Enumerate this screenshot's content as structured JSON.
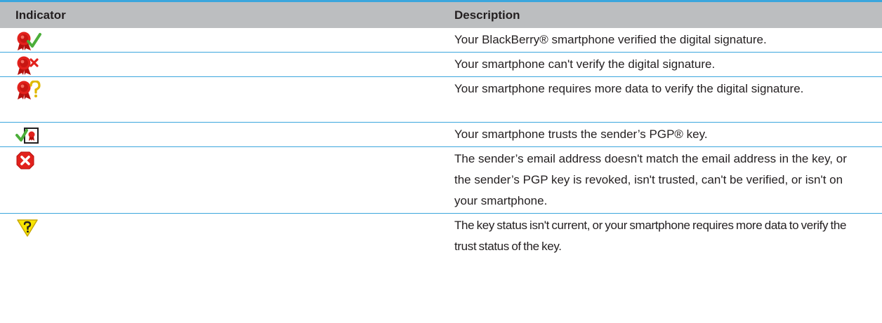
{
  "table": {
    "headers": {
      "indicator": "Indicator",
      "description": "Description"
    },
    "rows": [
      {
        "icon": "signature-verified-icon",
        "description": "Your BlackBerry® smartphone verified the digital signature."
      },
      {
        "icon": "signature-not-verified-icon",
        "description": "Your smartphone can't verify the digital signature."
      },
      {
        "icon": "signature-more-data-icon",
        "description": "Your smartphone requires more data to verify the digital signature."
      },
      {
        "icon": "pgp-key-trusted-icon",
        "description": "Your smartphone trusts the sender’s PGP® key."
      },
      {
        "icon": "pgp-key-error-icon",
        "description": "The sender’s email address doesn't match the email address in the key, or the sender’s PGP key is revoked, isn't trusted, can't be verified, or isn't on your smartphone."
      },
      {
        "icon": "key-status-unknown-icon",
        "description": "The key status isn't current, or your smartphone requires more data to verify the trust status of the key."
      }
    ]
  },
  "colors": {
    "header_bg": "#bcbec0",
    "rule": "#3ba6dd",
    "seal_red": "#e2211c",
    "check_green": "#4cae3a",
    "warning_yellow": "#f7e400"
  }
}
